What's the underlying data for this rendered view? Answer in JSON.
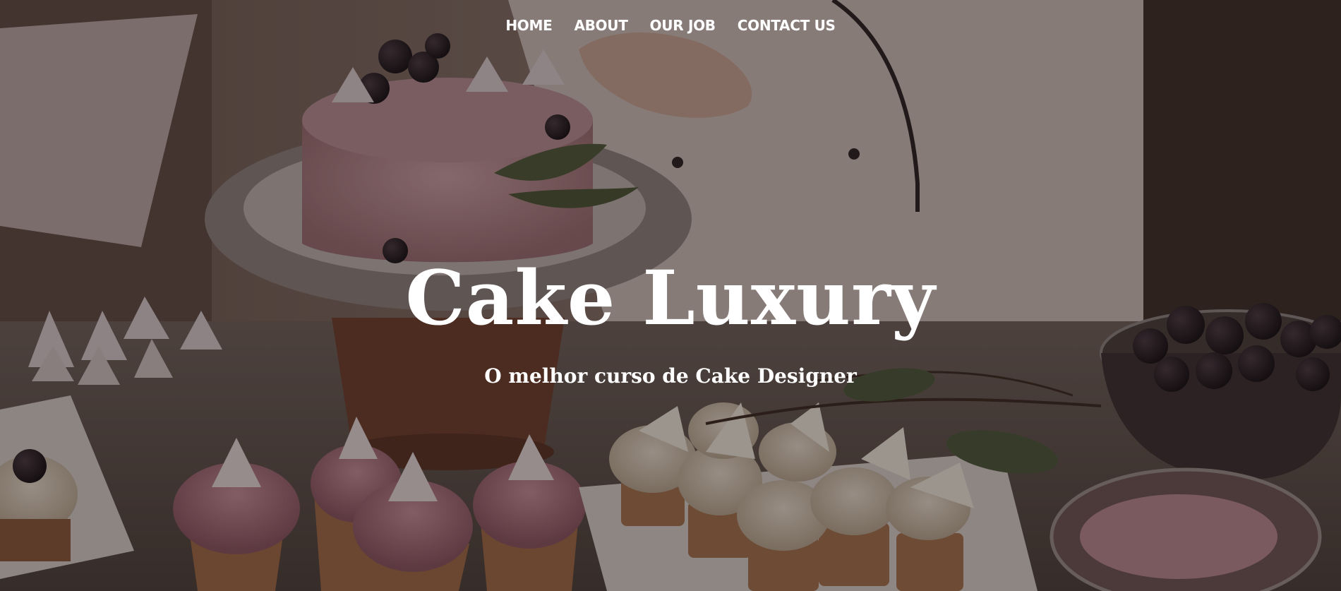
{
  "nav": {
    "items": [
      {
        "label": "HOME"
      },
      {
        "label": "ABOUT"
      },
      {
        "label": "OUR JOB"
      },
      {
        "label": "CONTACT US"
      }
    ]
  },
  "hero": {
    "title": "Cake Luxury",
    "subtitle": "O melhor curso de Cake Designer"
  },
  "colors": {
    "text": "#ffffff",
    "overlay": "#140c0a"
  }
}
